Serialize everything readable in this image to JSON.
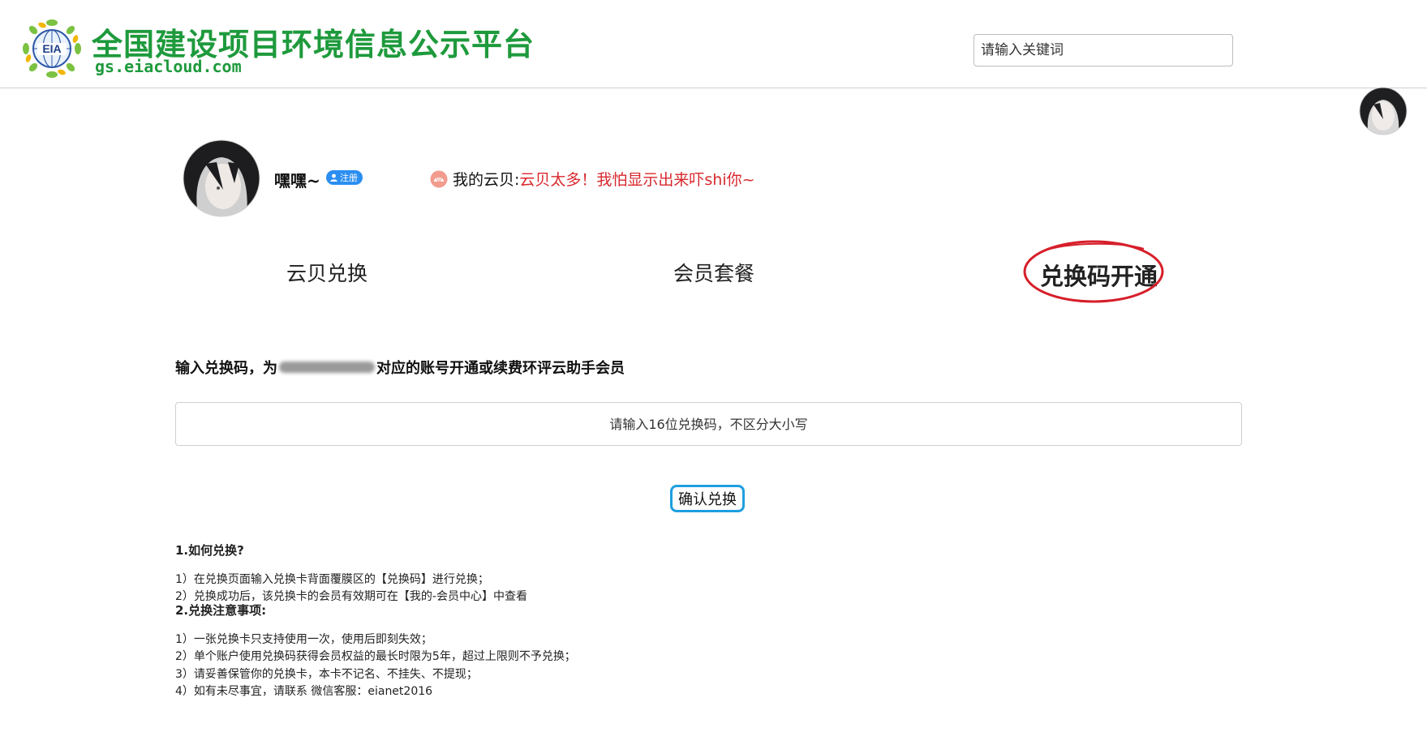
{
  "header": {
    "logo_text": "EIA",
    "site_title": "全国建设项目环境信息公示平台",
    "site_url": "gs.eiacloud.com",
    "search_placeholder": "请输入关键词"
  },
  "profile": {
    "username": "嘿嘿~",
    "badge": "注册",
    "coin_label": "我的云贝:",
    "coin_value": "云贝太多！我怕显示出来吓shi你~"
  },
  "tabs": [
    {
      "label": "云贝兑换",
      "active": false
    },
    {
      "label": "会员套餐",
      "active": false
    },
    {
      "label": "兑换码开通",
      "active": true
    }
  ],
  "redeem": {
    "title_prefix": "输入兑换码，为",
    "title_suffix": "对应的账号开通或续费环评云助手会员",
    "input_placeholder": "请输入16位兑换码，不区分大小写",
    "confirm_label": "确认兑换"
  },
  "notes": {
    "section1_title": "1.如何兑换?",
    "section1_items": [
      "1）在兑换页面输入兑换卡背面覆膜区的【兑换码】进行兑换；",
      "2）兑换成功后，该兑换卡的会员有效期可在【我的-会员中心】中查看"
    ],
    "section2_title": "2.兑换注意事项:",
    "section2_items": [
      "1）一张兑换卡只支持使用一次，使用后即刻失效；",
      "2）单个账户使用兑换码获得会员权益的最长时限为5年，超过上限则不予兑换；",
      "3）请妥善保管你的兑换卡，本卡不记名、不挂失、不提现；",
      "4）如有未尽事宜，请联系 微信客服：eianet2016"
    ]
  },
  "colors": {
    "brand_green": "#1e9a3c",
    "coin_red": "#d8282e",
    "highlight_circle": "#d61f2a",
    "button_border": "#1e9fe0",
    "badge_blue": "#2b8ef0"
  }
}
